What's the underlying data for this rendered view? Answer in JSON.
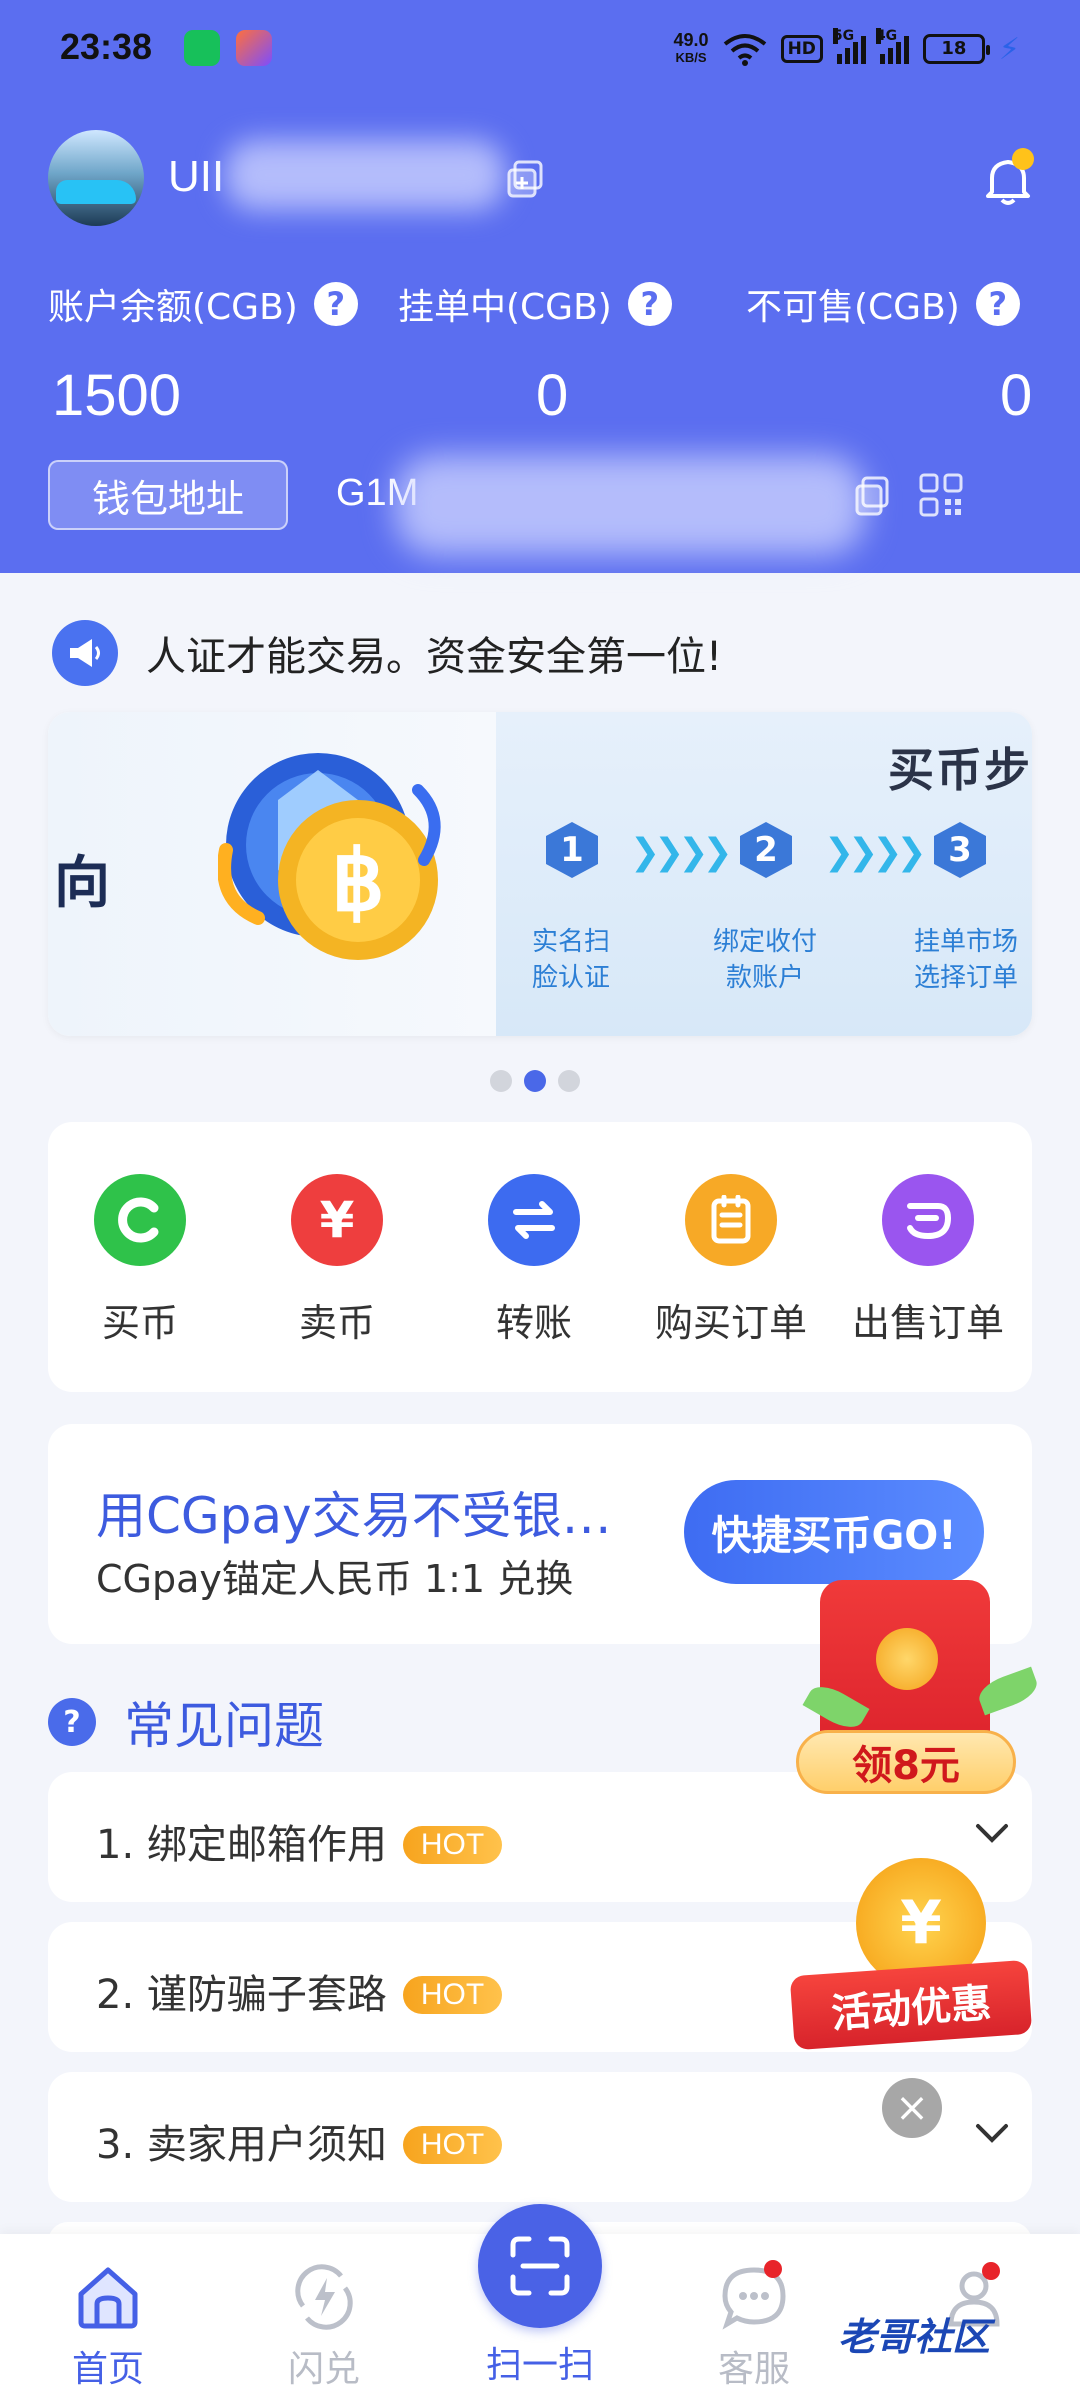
{
  "status_bar": {
    "time": "23:38",
    "net_speed": "49.0",
    "net_unit": "KB/S",
    "hd": "HD",
    "sig1": "5G",
    "sig2": "4G",
    "battery": "18"
  },
  "account": {
    "username": "UII",
    "labels": {
      "balance": "账户余额(CGB)",
      "pending": "挂单中(CGB)",
      "unsellable": "不可售(CGB)"
    },
    "values": {
      "balance": "1500",
      "pending": "0",
      "unsellable": "0"
    },
    "wallet_button": "钱包地址",
    "wallet_address": "G1M"
  },
  "notice": {
    "text": "人证才能交易。资金安全第一位!"
  },
  "banner": {
    "left_word": "向",
    "right_title": "买币步",
    "steps": [
      {
        "num": "1",
        "text_line1": "实名扫",
        "text_line2": "脸认证"
      },
      {
        "num": "2",
        "text_line1": "绑定收付",
        "text_line2": "款账户"
      },
      {
        "num": "3",
        "text_line1": "挂单市场",
        "text_line2": "选择订单"
      }
    ],
    "active_dot": 2
  },
  "quick_actions": [
    {
      "label": "买币",
      "icon": "buy-coin-icon",
      "color": "#2fc24a"
    },
    {
      "label": "卖币",
      "icon": "yen-icon",
      "color": "#ee3e3e"
    },
    {
      "label": "转账",
      "icon": "transfer-icon",
      "color": "#3d6bf0"
    },
    {
      "label": "购买订单",
      "icon": "buy-order-icon",
      "color": "#f7a926"
    },
    {
      "label": "出售订单",
      "icon": "sell-order-icon",
      "color": "#9a55ef"
    }
  ],
  "promo": {
    "title": "用CGpay交易不受银…",
    "subtitle": "CGpay锚定人民币 1:1 兑换",
    "button": "快捷买币GO!"
  },
  "faq": {
    "title": "常见问题",
    "items": [
      {
        "text": "1.  绑定邮箱作用",
        "badge": "HOT"
      },
      {
        "text": "2.  谨防骗子套路",
        "badge": "HOT"
      },
      {
        "text": "3.  卖家用户须知",
        "badge": "HOT"
      }
    ]
  },
  "floats": {
    "red_packet_label": "领8元",
    "promo_label": "活动优惠",
    "promo_coin_symbol": "¥"
  },
  "bottom_nav": {
    "home": "首页",
    "flash": "闪兑",
    "scan": "扫一扫",
    "service": "客服",
    "mine_watermark": "老哥社区"
  },
  "colors": {
    "header_bg": "#5b6ef0",
    "accent": "#4560e6",
    "hot_badge": "#f7a41e"
  }
}
